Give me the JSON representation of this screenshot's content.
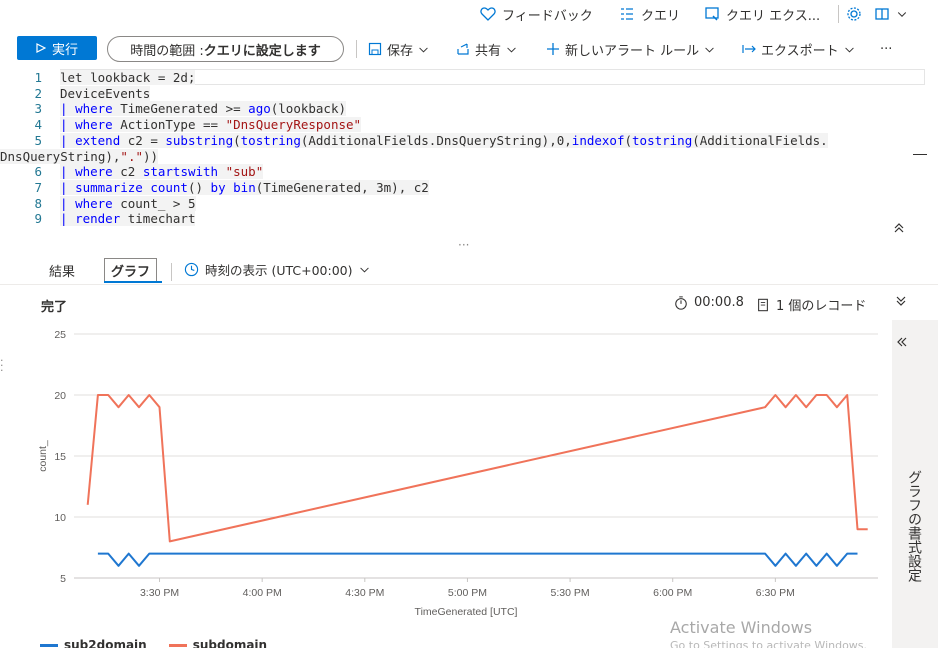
{
  "topbar": {
    "feedback_label": "フィードバック",
    "queries_label": "クエリ",
    "query_explorer_label": "クエリ エクス..."
  },
  "toolbar": {
    "run_label": "実行",
    "time_range_prefix": "時間の範囲 : ",
    "time_range_value": "クエリに設定します",
    "save_label": "保存",
    "share_label": "共有",
    "new_alert_label": "新しいアラート ルール",
    "export_label": "エクスポート"
  },
  "editor": {
    "lines": [
      {
        "n": "1",
        "html": "let lookback = 2d;"
      },
      {
        "n": "2",
        "html": "DeviceEvents"
      },
      {
        "n": "3",
        "html": "| where TimeGenerated >= ago(lookback)"
      },
      {
        "n": "4",
        "html": "| where ActionType == \"DnsQueryResponse\""
      },
      {
        "n": "5",
        "html": "| extend c2 = substring(tostring(AdditionalFields.DnsQueryString),0,indexof(tostring(AdditionalFields."
      },
      {
        "n": "",
        "html": "DnsQueryString),\".\"))"
      },
      {
        "n": "6",
        "html": "| where c2 startswith \"sub\""
      },
      {
        "n": "7",
        "html": "| summarize count() by bin(TimeGenerated, 3m), c2"
      },
      {
        "n": "8",
        "html": "| where count_ > 5"
      },
      {
        "n": "9",
        "html": "| render timechart"
      }
    ]
  },
  "results_tabs": {
    "results_label": "結果",
    "chart_label": "グラフ",
    "timezone_label": "時刻の表示 (UTC+00:00)"
  },
  "status": {
    "title": "完了",
    "duration": "00:00.8",
    "records": "1 個のレコード"
  },
  "right_panel": {
    "label": "グラフの書式設定"
  },
  "watermark": {
    "line1": "Activate Windows",
    "line2": "Go to Settings to activate Windows."
  },
  "colors": {
    "accent": "#0078d4",
    "subdomain": "#f0735a",
    "sub2domain": "#1f77d0"
  },
  "chart_data": {
    "type": "line",
    "xlabel": "TimeGenerated [UTC]",
    "ylabel": "count_",
    "ylim": [
      5,
      25
    ],
    "yticks": [
      5,
      10,
      15,
      20,
      25
    ],
    "xticks": [
      "3:30 PM",
      "4:00 PM",
      "4:30 PM",
      "5:00 PM",
      "5:30 PM",
      "6:00 PM",
      "6:30 PM"
    ],
    "x_minutes_ticks": [
      930,
      960,
      990,
      1020,
      1050,
      1080,
      1110
    ],
    "legend_position": "bottom-left",
    "series": [
      {
        "name": "subdomain",
        "color": "#f0735a",
        "x": [
          909,
          912,
          915,
          918,
          921,
          924,
          927,
          930,
          933,
          1107,
          1110,
          1113,
          1116,
          1119,
          1122,
          1125,
          1128,
          1131,
          1134,
          1137
        ],
        "y": [
          11,
          20,
          20,
          19,
          20,
          19,
          20,
          19,
          8,
          19,
          20,
          19,
          20,
          19,
          20,
          20,
          19,
          20,
          9,
          9
        ],
        "display": "11,20,20,19,20,19,20,19,8 → 19,20,19,20,19,20,20,19,20,9"
      },
      {
        "name": "sub2domain",
        "color": "#1f77d0",
        "x": [
          912,
          915,
          918,
          921,
          924,
          927,
          930,
          1107,
          1110,
          1113,
          1116,
          1119,
          1122,
          1125,
          1128,
          1131,
          1134
        ],
        "y": [
          7,
          7,
          6,
          7,
          6,
          7,
          7,
          7,
          6,
          7,
          6,
          7,
          6,
          7,
          6,
          7,
          7
        ]
      }
    ]
  }
}
